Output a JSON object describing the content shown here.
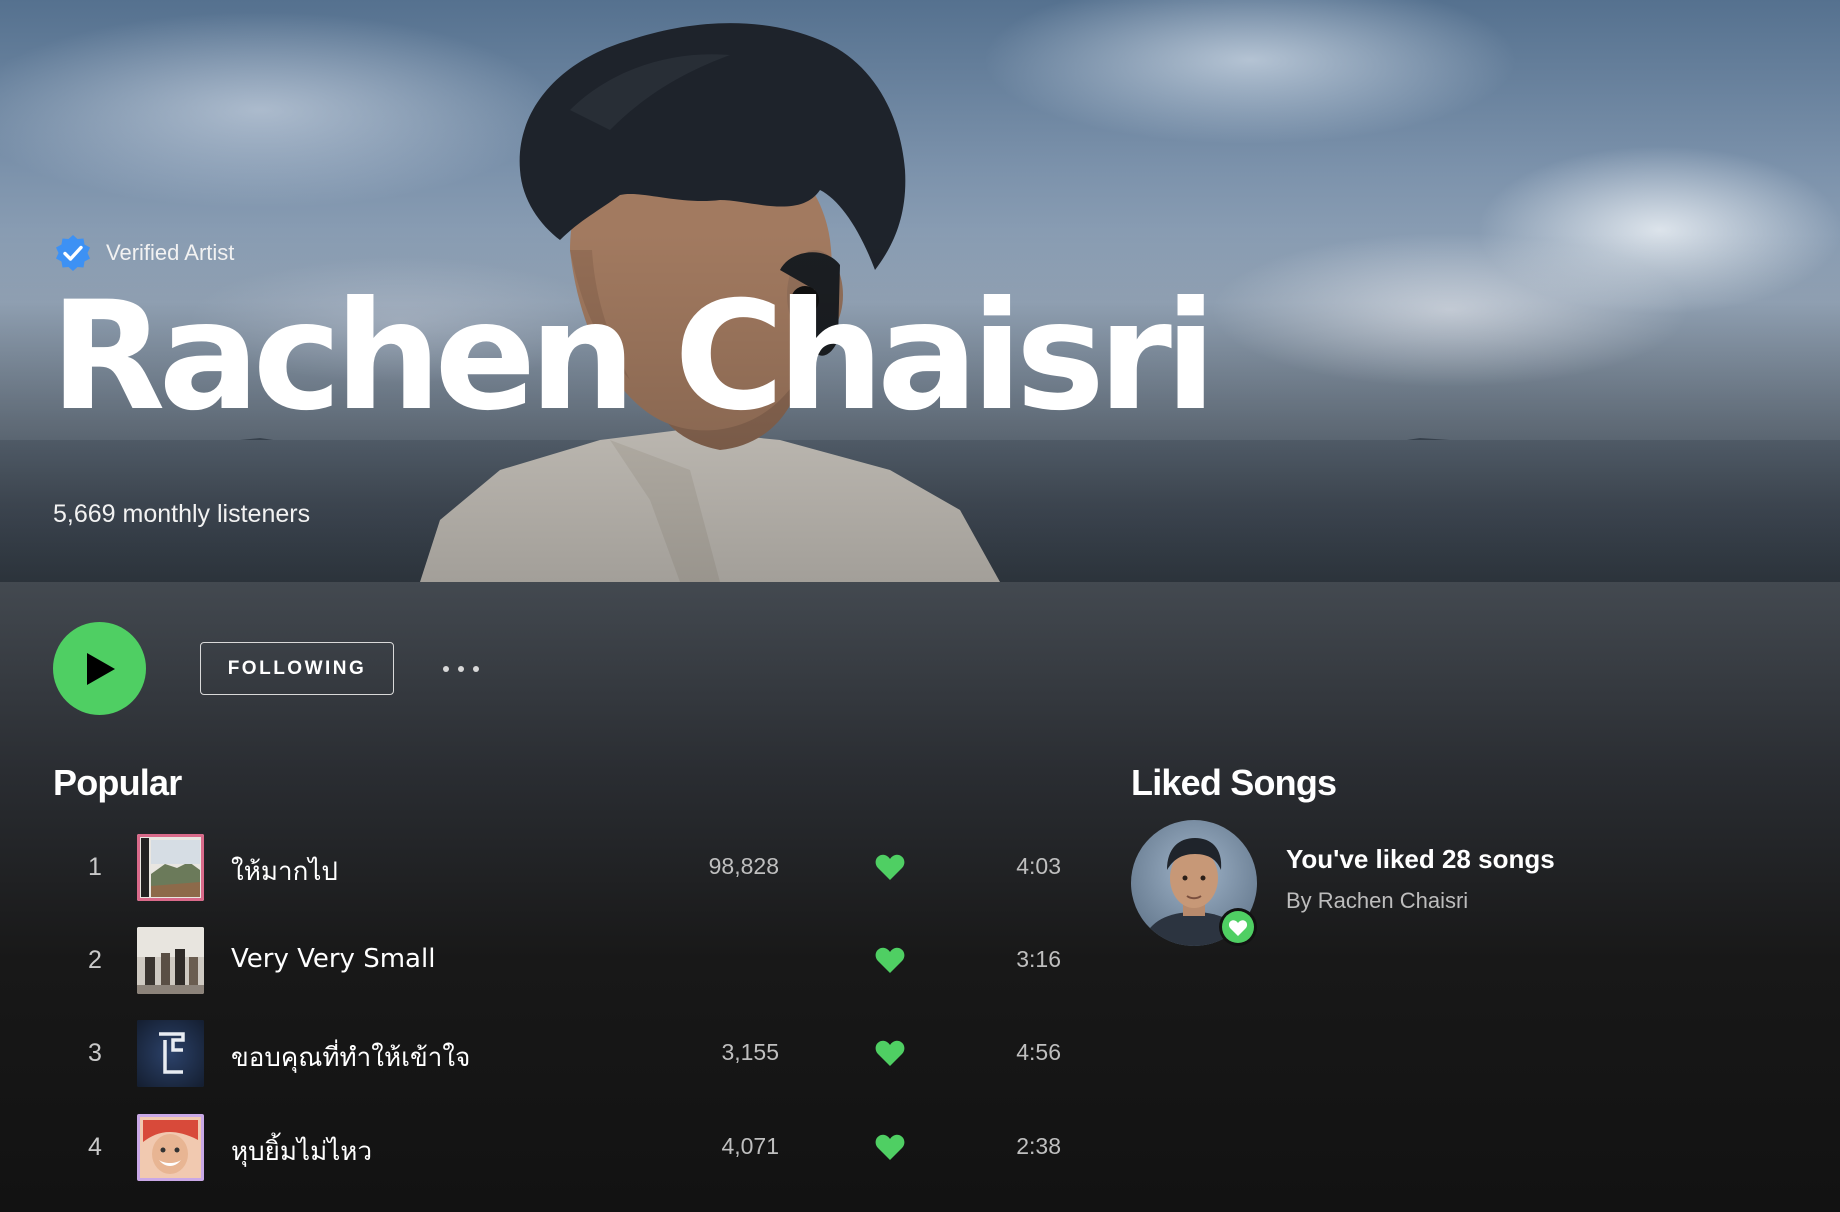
{
  "artist": {
    "verified_label": "Verified Artist",
    "name": "Rachen Chaisri",
    "monthly_listeners": "5,669 monthly listeners"
  },
  "actions": {
    "follow_label": "FOLLOWING"
  },
  "popular": {
    "title": "Popular",
    "tracks": [
      {
        "number": "1",
        "title": "ให้มากไป",
        "plays": "98,828",
        "liked": true,
        "duration": "4:03"
      },
      {
        "number": "2",
        "title": "Very Very Small",
        "plays": "",
        "liked": true,
        "duration": "3:16"
      },
      {
        "number": "3",
        "title": "ขอบคุณที่ทำให้เข้าใจ",
        "plays": "3,155",
        "liked": true,
        "duration": "4:56"
      },
      {
        "number": "4",
        "title": "หุบยิ้มไม่ไหว",
        "plays": "4,071",
        "liked": true,
        "duration": "2:38"
      }
    ]
  },
  "liked_songs": {
    "title": "Liked Songs",
    "summary": "You've liked 28 songs",
    "by": "By Rachen Chaisri"
  },
  "icons": {
    "verified": "verified-badge-icon",
    "play": "play-icon",
    "more": "more-options-icon",
    "heart": "heart-icon"
  },
  "colors": {
    "accent_green": "#4fcf63",
    "verified_blue": "#3d91f4",
    "background": "#121212"
  }
}
